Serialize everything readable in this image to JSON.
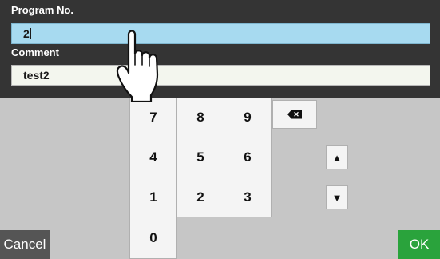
{
  "form": {
    "program_label": "Program No.",
    "program_value": "2",
    "comment_label": "Comment",
    "comment_value": "test2"
  },
  "keypad": {
    "keys": [
      "7",
      "8",
      "9",
      "4",
      "5",
      "6",
      "1",
      "2",
      "3",
      "0"
    ],
    "backspace_icon": "backspace-icon",
    "up_arrow": "▲",
    "down_arrow": "▼"
  },
  "footer": {
    "cancel_label": "Cancel",
    "ok_label": "OK"
  },
  "colors": {
    "header_bg": "#343434",
    "panel_bg": "#c6c6c6",
    "selected_field": "#a7daf0",
    "ok_green": "#2aa33c",
    "cancel_gray": "#555555"
  }
}
